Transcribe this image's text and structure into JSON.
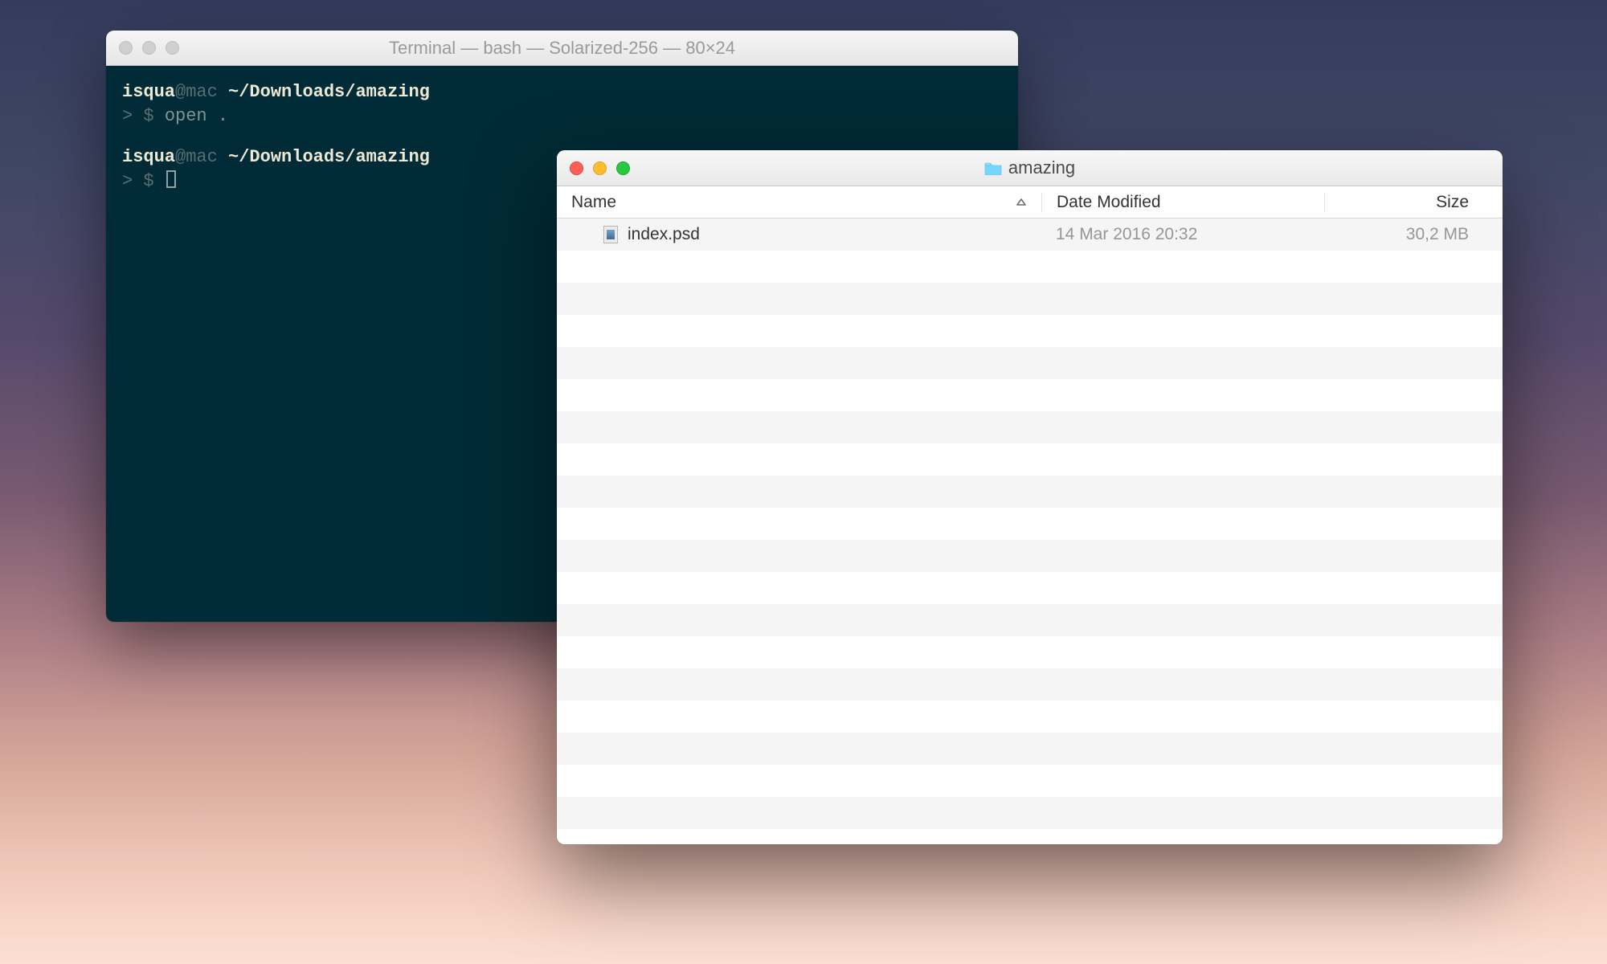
{
  "terminal": {
    "title": "Terminal — bash — Solarized-256 — 80×24",
    "prompt1": {
      "user": "isqua",
      "at": "@",
      "host": "mac ",
      "path": "~/Downloads/amazing"
    },
    "line1": {
      "arrow": "> ",
      "dollar": "$ ",
      "cmd": "open ."
    },
    "prompt2": {
      "user": "isqua",
      "at": "@",
      "host": "mac ",
      "path": "~/Downloads/amazing"
    },
    "line2": {
      "arrow": "> ",
      "dollar": "$ "
    }
  },
  "finder": {
    "title": "amazing",
    "columns": {
      "name": "Name",
      "date": "Date Modified",
      "size": "Size"
    },
    "files": [
      {
        "name": "index.psd",
        "date": "14 Mar 2016 20:32",
        "size": "30,2 MB"
      }
    ]
  }
}
